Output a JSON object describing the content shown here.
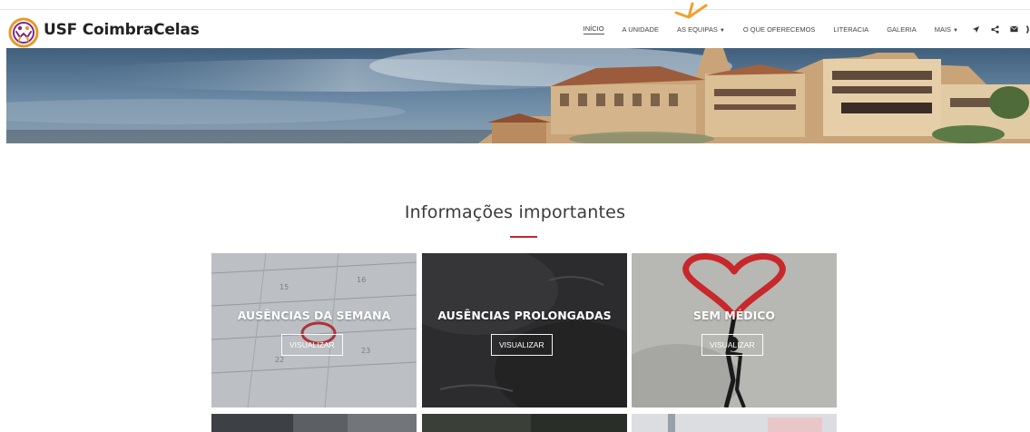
{
  "header": {
    "brand": "USF CoimbraCelas",
    "nav": [
      {
        "label": "INÍCIO",
        "active": true
      },
      {
        "label": "A UNIDADE"
      },
      {
        "label": "AS EQUIPAS",
        "dropdown": true
      },
      {
        "label": "O QUE OFERECEMOS"
      },
      {
        "label": "LITERACIA"
      },
      {
        "label": "GALERIA"
      },
      {
        "label": "MAIS",
        "dropdown": true
      }
    ],
    "icons": [
      "send-icon",
      "share-icon",
      "mail-icon",
      "phone-icon"
    ]
  },
  "section": {
    "title": "Informações importantes",
    "accent_color": "#c0282d"
  },
  "cards": [
    {
      "title": "AUSÊNCIAS DA SEMANA",
      "button": "VISUALIZAR"
    },
    {
      "title": "AUSÊNCIAS PROLONGADAS",
      "button": "VISUALIZAR"
    },
    {
      "title": "SEM MÉDICO",
      "button": "VISUALIZAR"
    }
  ],
  "colors": {
    "highlight_arrow": "#f0a030"
  }
}
